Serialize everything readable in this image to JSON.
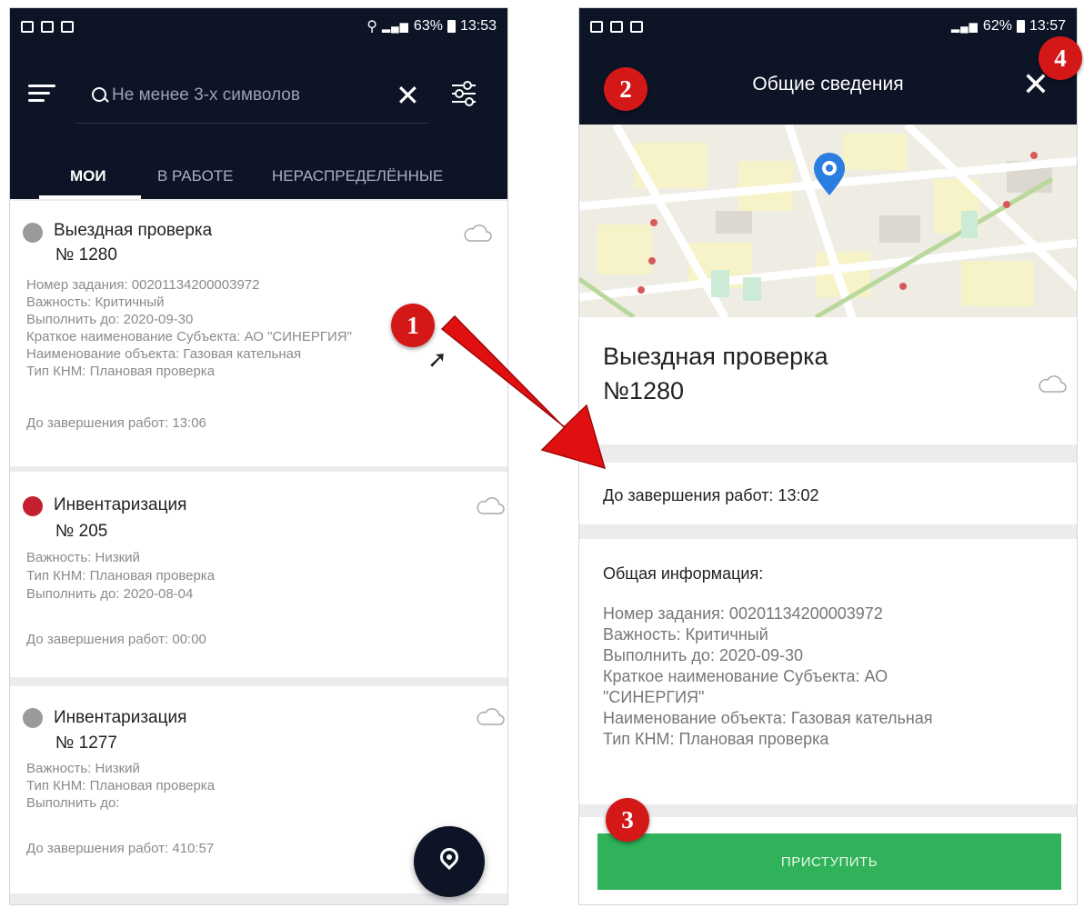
{
  "left_screen": {
    "status_bar": {
      "battery": "63%",
      "time": "13:53"
    },
    "search": {
      "placeholder": "Не менее 3-х символов"
    },
    "tabs": [
      {
        "label": "МОИ",
        "active": true
      },
      {
        "label": "В РАБОТЕ",
        "active": false
      },
      {
        "label": "НЕРАСПРЕДЕЛЁННЫЕ",
        "active": false
      }
    ],
    "cards": [
      {
        "status_color": "#9a9a9a",
        "title": "Выездная проверка",
        "number": "№ 1280",
        "lines": [
          "Номер задания: 00201134200003972",
          "Важность: Критичный",
          "Выполнить до: 2020-09-30",
          "Краткое наименование Субъекта: АО \"СИНЕРГИЯ\"",
          "Наименование объекта: Газовая кательная",
          "Тип КНМ: Плановая проверка"
        ],
        "time_left": "До завершения работ: 13:06"
      },
      {
        "status_color": "#c41f2e",
        "title": "Инвентаризация",
        "number": "№ 205",
        "lines": [
          "Важность: Низкий",
          "Тип КНМ: Плановая проверка",
          "Выполнить до: 2020-08-04"
        ],
        "time_left": "До завершения работ: 00:00"
      },
      {
        "status_color": "#9a9a9a",
        "title": "Инвентаризация",
        "number": "№ 1277",
        "lines": [
          "Важность: Низкий",
          "Тип КНМ: Плановая проверка",
          "Выполнить до:"
        ],
        "time_left": "До завершения работ: 410:57"
      }
    ]
  },
  "right_screen": {
    "status_bar": {
      "battery": "62%",
      "time": "13:57"
    },
    "title": "Общие сведения",
    "close_icon": "close-icon",
    "task_title": "Выездная проверка",
    "task_number": "№1280",
    "time_left": "До завершения работ: 13:02",
    "info_heading": "Общая информация:",
    "info_lines": [
      "Номер задания: 00201134200003972",
      "Важность: Критичный",
      "Выполнить до: 2020-09-30",
      "Краткое наименование Субъекта: АО",
      "\"СИНЕРГИЯ\"",
      "Наименование объекта: Газовая кательная",
      "Тип КНМ: Плановая проверка"
    ],
    "start_button": "ПРИСТУПИТЬ"
  },
  "annotations": {
    "badges": [
      "1",
      "2",
      "3",
      "4"
    ],
    "badge_color": "#d41818",
    "arrow_color": "#e01010"
  },
  "colors": {
    "header": "#0d1426",
    "accent_green": "#2fb25a",
    "map_pin": "#2a7de1"
  }
}
